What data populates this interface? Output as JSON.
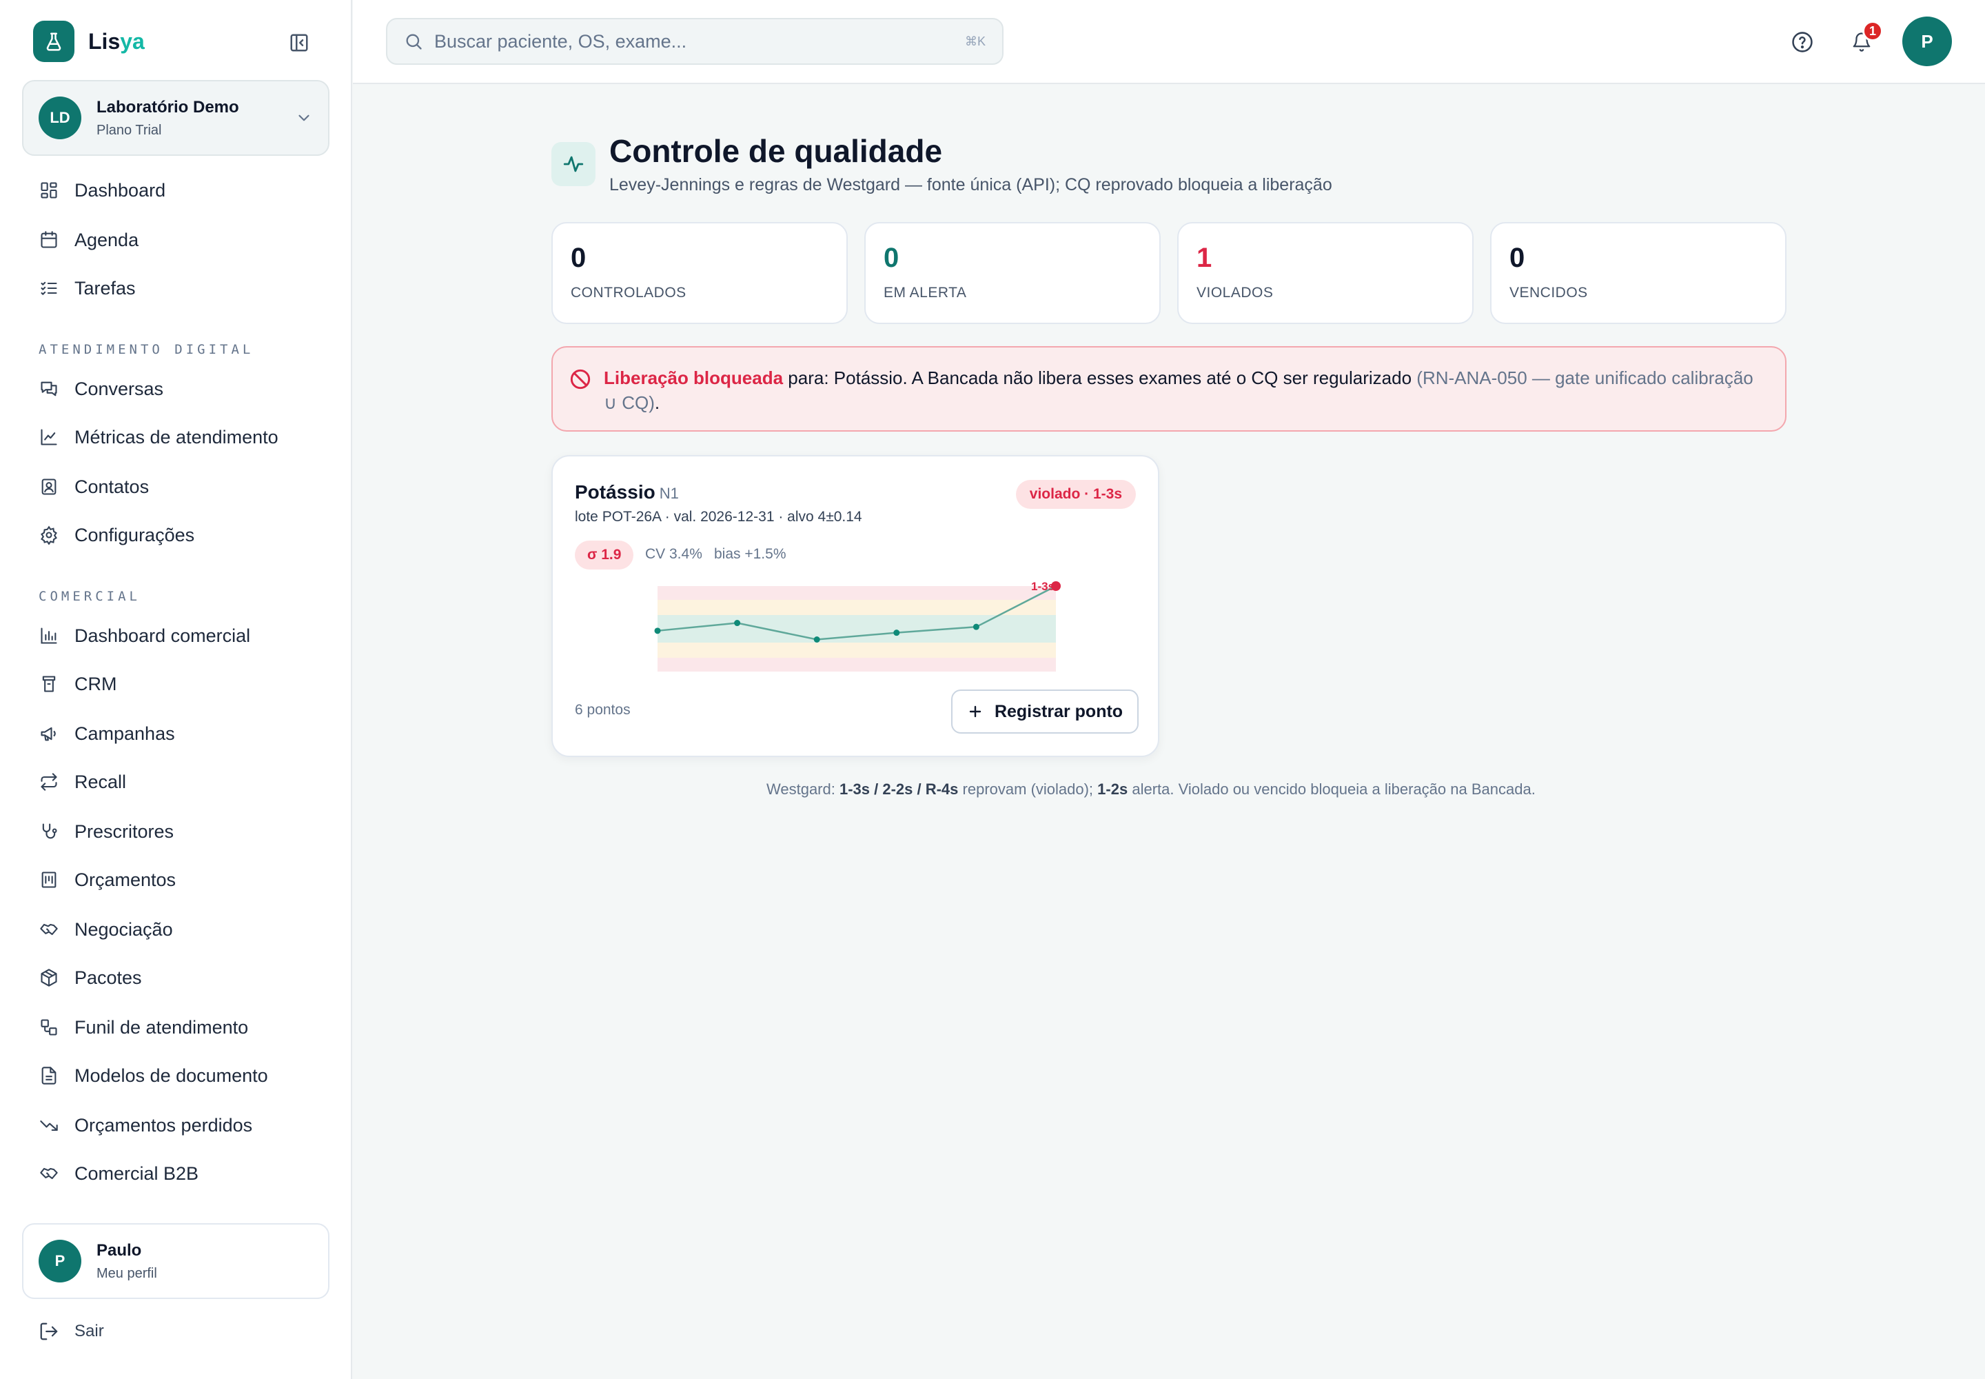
{
  "brand": {
    "name_main": "Lis",
    "name_accent": "ya"
  },
  "org": {
    "initials": "LD",
    "name": "Laboratório Demo",
    "plan": "Plano Trial"
  },
  "nav_main": [
    {
      "label": "Dashboard",
      "icon": "dashboard-icon"
    },
    {
      "label": "Agenda",
      "icon": "calendar-icon"
    },
    {
      "label": "Tarefas",
      "icon": "checklist-icon"
    }
  ],
  "section_digital": "ATENDIMENTO DIGITAL",
  "nav_digital": [
    {
      "label": "Conversas",
      "icon": "chat-icon"
    },
    {
      "label": "Métricas de atendimento",
      "icon": "line-chart-icon"
    },
    {
      "label": "Contatos",
      "icon": "contact-icon"
    },
    {
      "label": "Configurações",
      "icon": "gear-icon"
    }
  ],
  "section_comercial": "COMERCIAL",
  "nav_comercial": [
    {
      "label": "Dashboard comercial",
      "icon": "bar-chart-icon"
    },
    {
      "label": "CRM",
      "icon": "crm-icon"
    },
    {
      "label": "Campanhas",
      "icon": "megaphone-icon"
    },
    {
      "label": "Recall",
      "icon": "repeat-icon"
    },
    {
      "label": "Prescritores",
      "icon": "stethoscope-icon"
    },
    {
      "label": "Orçamentos",
      "icon": "receipt-icon"
    },
    {
      "label": "Negociação",
      "icon": "handshake-icon"
    },
    {
      "label": "Pacotes",
      "icon": "package-icon"
    },
    {
      "label": "Funil de atendimento",
      "icon": "workflow-icon"
    },
    {
      "label": "Modelos de documento",
      "icon": "document-icon"
    },
    {
      "label": "Orçamentos perdidos",
      "icon": "trending-down-icon"
    },
    {
      "label": "Comercial B2B",
      "icon": "handshake-icon"
    }
  ],
  "user": {
    "initial": "P",
    "name": "Paulo",
    "subtitle": "Meu perfil"
  },
  "logout_label": "Sair",
  "search": {
    "placeholder": "Buscar paciente, OS, exame...",
    "shortcut": "⌘K"
  },
  "notifications": {
    "count": "1"
  },
  "top_avatar": "P",
  "page": {
    "title": "Controle de qualidade",
    "subtitle": "Levey-Jennings e regras de Westgard — fonte única (API); CQ reprovado bloqueia a liberação"
  },
  "stats": [
    {
      "value": "0",
      "label": "CONTROLADOS",
      "color": "#0f172a"
    },
    {
      "value": "0",
      "label": "EM ALERTA",
      "color": "#0f766e"
    },
    {
      "value": "1",
      "label": "VIOLADOS",
      "color": "#dc2646"
    },
    {
      "value": "0",
      "label": "VENCIDOS",
      "color": "#0f172a"
    }
  ],
  "alert": {
    "strong": "Liberação bloqueada",
    "text": " para: Potássio. A Bancada não libera esses exames até o CQ ser regularizado ",
    "muted": "(RN-ANA-050 — gate unificado calibração ∪ CQ)",
    "end": "."
  },
  "qc_card": {
    "analyte": "Potássio",
    "level": "N1",
    "meta": "lote POT-26A · val. 2026-12-31 · alvo 4±0.14",
    "status": "violado · 1-3s",
    "sigma": "σ 1.9",
    "cv": "CV 3.4%",
    "bias": "bias +1.5%",
    "points_count": "6 pontos",
    "register_label": "Registrar ponto"
  },
  "chart_data": {
    "type": "line",
    "x": [
      1,
      2,
      3,
      4,
      5,
      6
    ],
    "series": [
      {
        "values": [
          4.0,
          4.08,
          3.91,
          3.98,
          4.04,
          4.46
        ]
      }
    ],
    "target_mean": 4.0,
    "sd": 0.14,
    "ylim": [
      3.58,
      4.46
    ],
    "violation_point_index": 5,
    "violation_label": "1-3s",
    "colors": {
      "line": "#5fa89a",
      "point": "#0f8a78",
      "violation": "#dc2646"
    }
  },
  "footer": {
    "prefix": "Westgard: ",
    "rules_fail": "1-3s / 2-2s / R-4s",
    "middle": " reprovam (violado); ",
    "rule_alert": "1-2s",
    "suffix": " alerta. Violado ou vencido bloqueia a liberação na Bancada."
  }
}
